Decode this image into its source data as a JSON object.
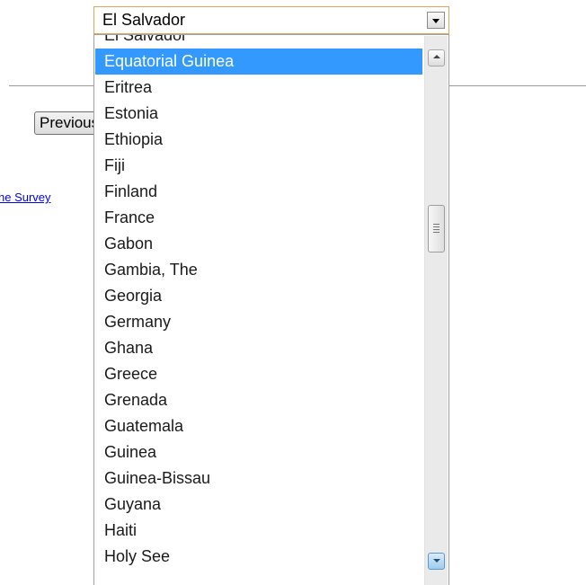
{
  "page": {
    "previous_button_label": "Previous",
    "survey_link_text": "he Survey"
  },
  "country_select": {
    "selected_value": "El Salvador",
    "highlighted_option": "Equatorial Guinea",
    "visible_options": [
      "El Salvador",
      "Equatorial Guinea",
      "Eritrea",
      "Estonia",
      "Ethiopia",
      "Fiji",
      "Finland",
      "France",
      "Gabon",
      "Gambia, The",
      "Georgia",
      "Germany",
      "Ghana",
      "Greece",
      "Grenada",
      "Guatemala",
      "Guinea",
      "Guinea-Bissau",
      "Guyana",
      "Haiti",
      "Holy See"
    ],
    "scroll_position_fraction": 0.36
  },
  "colors": {
    "highlight": "#3399ff",
    "focus_border": "#e3a55b",
    "link": "#0000ee"
  },
  "icons": {
    "select_arrow": "chevron-down-icon",
    "scroll_up": "scroll-up-arrow-icon",
    "scroll_down": "scroll-down-arrow-icon"
  }
}
